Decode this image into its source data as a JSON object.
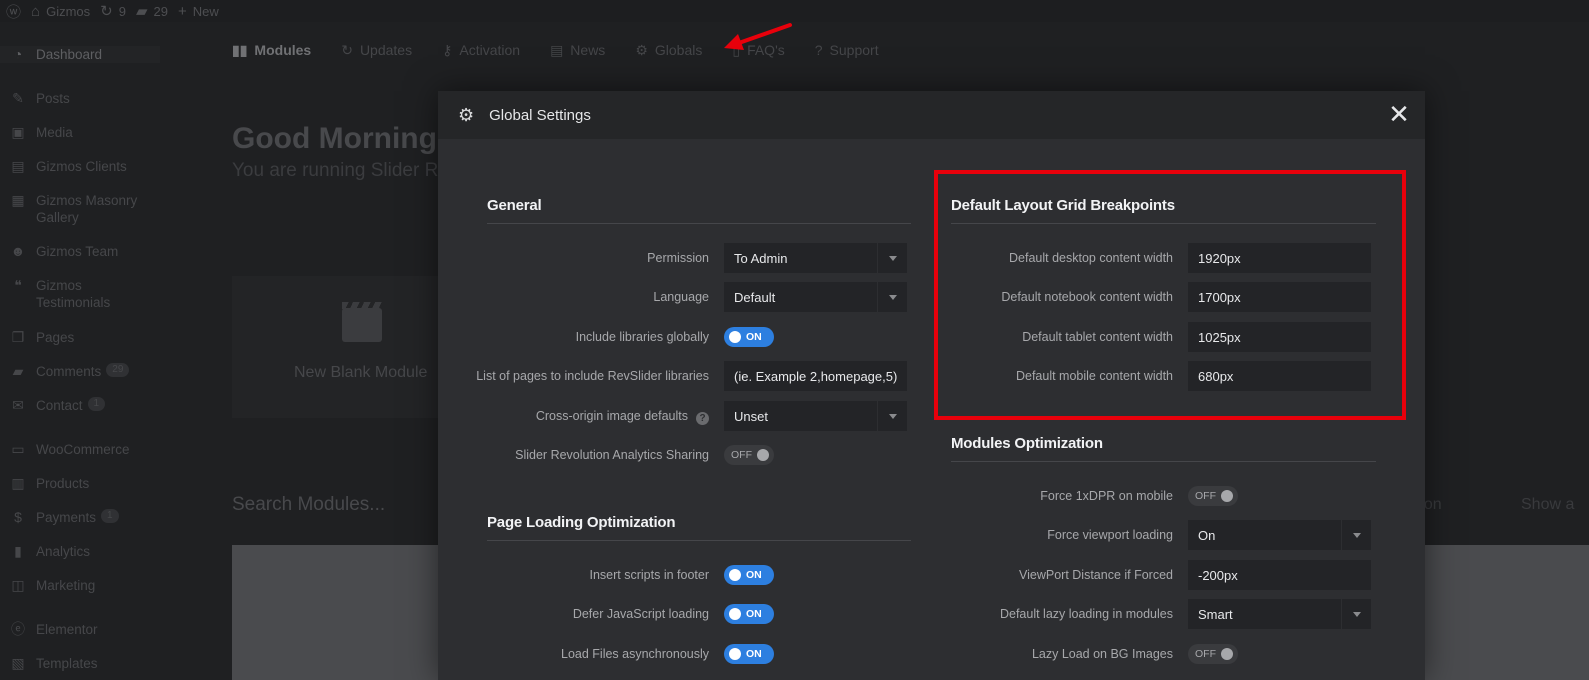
{
  "admin_bar": {
    "site_name": "Gizmos",
    "updates_count": "9",
    "comments_count": "29",
    "new_label": "New"
  },
  "sidebar": {
    "items": [
      {
        "label": "Dashboard",
        "icon": "dashboard-icon"
      },
      {
        "label": "Posts",
        "icon": "pin-icon"
      },
      {
        "label": "Media",
        "icon": "media-icon"
      },
      {
        "label": "Gizmos Clients",
        "icon": "clients-icon"
      },
      {
        "label": "Gizmos Masonry Gallery",
        "icon": "gallery-icon"
      },
      {
        "label": "Gizmos Team",
        "icon": "team-icon"
      },
      {
        "label": "Gizmos Testimonials",
        "icon": "testimonials-icon"
      },
      {
        "label": "Pages",
        "icon": "pages-icon"
      },
      {
        "label": "Comments",
        "icon": "comments-icon",
        "badge": "29"
      },
      {
        "label": "Contact",
        "icon": "mail-icon",
        "badge": "1"
      },
      {
        "label": "WooCommerce",
        "icon": "woocommerce-icon"
      },
      {
        "label": "Products",
        "icon": "products-icon"
      },
      {
        "label": "Payments",
        "icon": "payments-icon",
        "badge": "1"
      },
      {
        "label": "Analytics",
        "icon": "analytics-icon"
      },
      {
        "label": "Marketing",
        "icon": "marketing-icon"
      },
      {
        "label": "Elementor",
        "icon": "elementor-icon"
      },
      {
        "label": "Templates",
        "icon": "templates-icon"
      }
    ]
  },
  "tabs": [
    {
      "label": "Modules",
      "icon": "modules-icon"
    },
    {
      "label": "Updates",
      "icon": "updates-icon"
    },
    {
      "label": "Activation",
      "icon": "key-icon"
    },
    {
      "label": "News",
      "icon": "news-icon"
    },
    {
      "label": "Globals",
      "icon": "gear-icon"
    },
    {
      "label": "FAQ's",
      "icon": "book-icon"
    },
    {
      "label": "Support",
      "icon": "help-icon"
    }
  ],
  "main": {
    "greeting": "Good Morning a",
    "subgreeting": "You are running Slider R",
    "blank_module_label": "New Blank Module",
    "search_label": "Search Modules...",
    "sort_fragment": "ation",
    "show_fragment": "Show a"
  },
  "modal": {
    "title": "Global Settings",
    "general": {
      "title": "General",
      "permission_label": "Permission",
      "permission_value": "To Admin",
      "language_label": "Language",
      "language_value": "Default",
      "include_libs_label": "Include libraries globally",
      "include_libs_state": "ON",
      "pages_list_label": "List of pages to include RevSlider libraries",
      "pages_list_placeholder": "(ie. Example 2,homepage,5)",
      "cross_origin_label": "Cross-origin image defaults",
      "cross_origin_value": "Unset",
      "analytics_label": "Slider Revolution Analytics Sharing",
      "analytics_state": "OFF"
    },
    "page_loading": {
      "title": "Page Loading Optimization",
      "scripts_footer_label": "Insert scripts in footer",
      "scripts_footer_state": "ON",
      "defer_js_label": "Defer JavaScript loading",
      "defer_js_state": "ON",
      "async_label": "Load Files asynchronously",
      "async_state": "ON"
    },
    "breakpoints": {
      "title": "Default Layout Grid Breakpoints",
      "desktop_label": "Default desktop content width",
      "desktop_value": "1920px",
      "notebook_label": "Default notebook content width",
      "notebook_value": "1700px",
      "tablet_label": "Default tablet content width",
      "tablet_value": "1025px",
      "mobile_label": "Default mobile content width",
      "mobile_value": "680px"
    },
    "modules_opt": {
      "title": "Modules Optimization",
      "force_dpr_label": "Force 1xDPR on mobile",
      "force_dpr_state": "OFF",
      "force_viewport_label": "Force viewport loading",
      "force_viewport_value": "On",
      "viewport_distance_label": "ViewPort Distance if Forced",
      "viewport_distance_value": "-200px",
      "lazy_loading_label": "Default lazy loading in modules",
      "lazy_loading_value": "Smart",
      "lazy_bg_label": "Lazy Load on BG Images",
      "lazy_bg_state": "OFF"
    }
  },
  "colors": {
    "accent_blue": "#2d7fe0",
    "highlight_red": "#e8000b",
    "modal_bg": "#2d2e31"
  }
}
